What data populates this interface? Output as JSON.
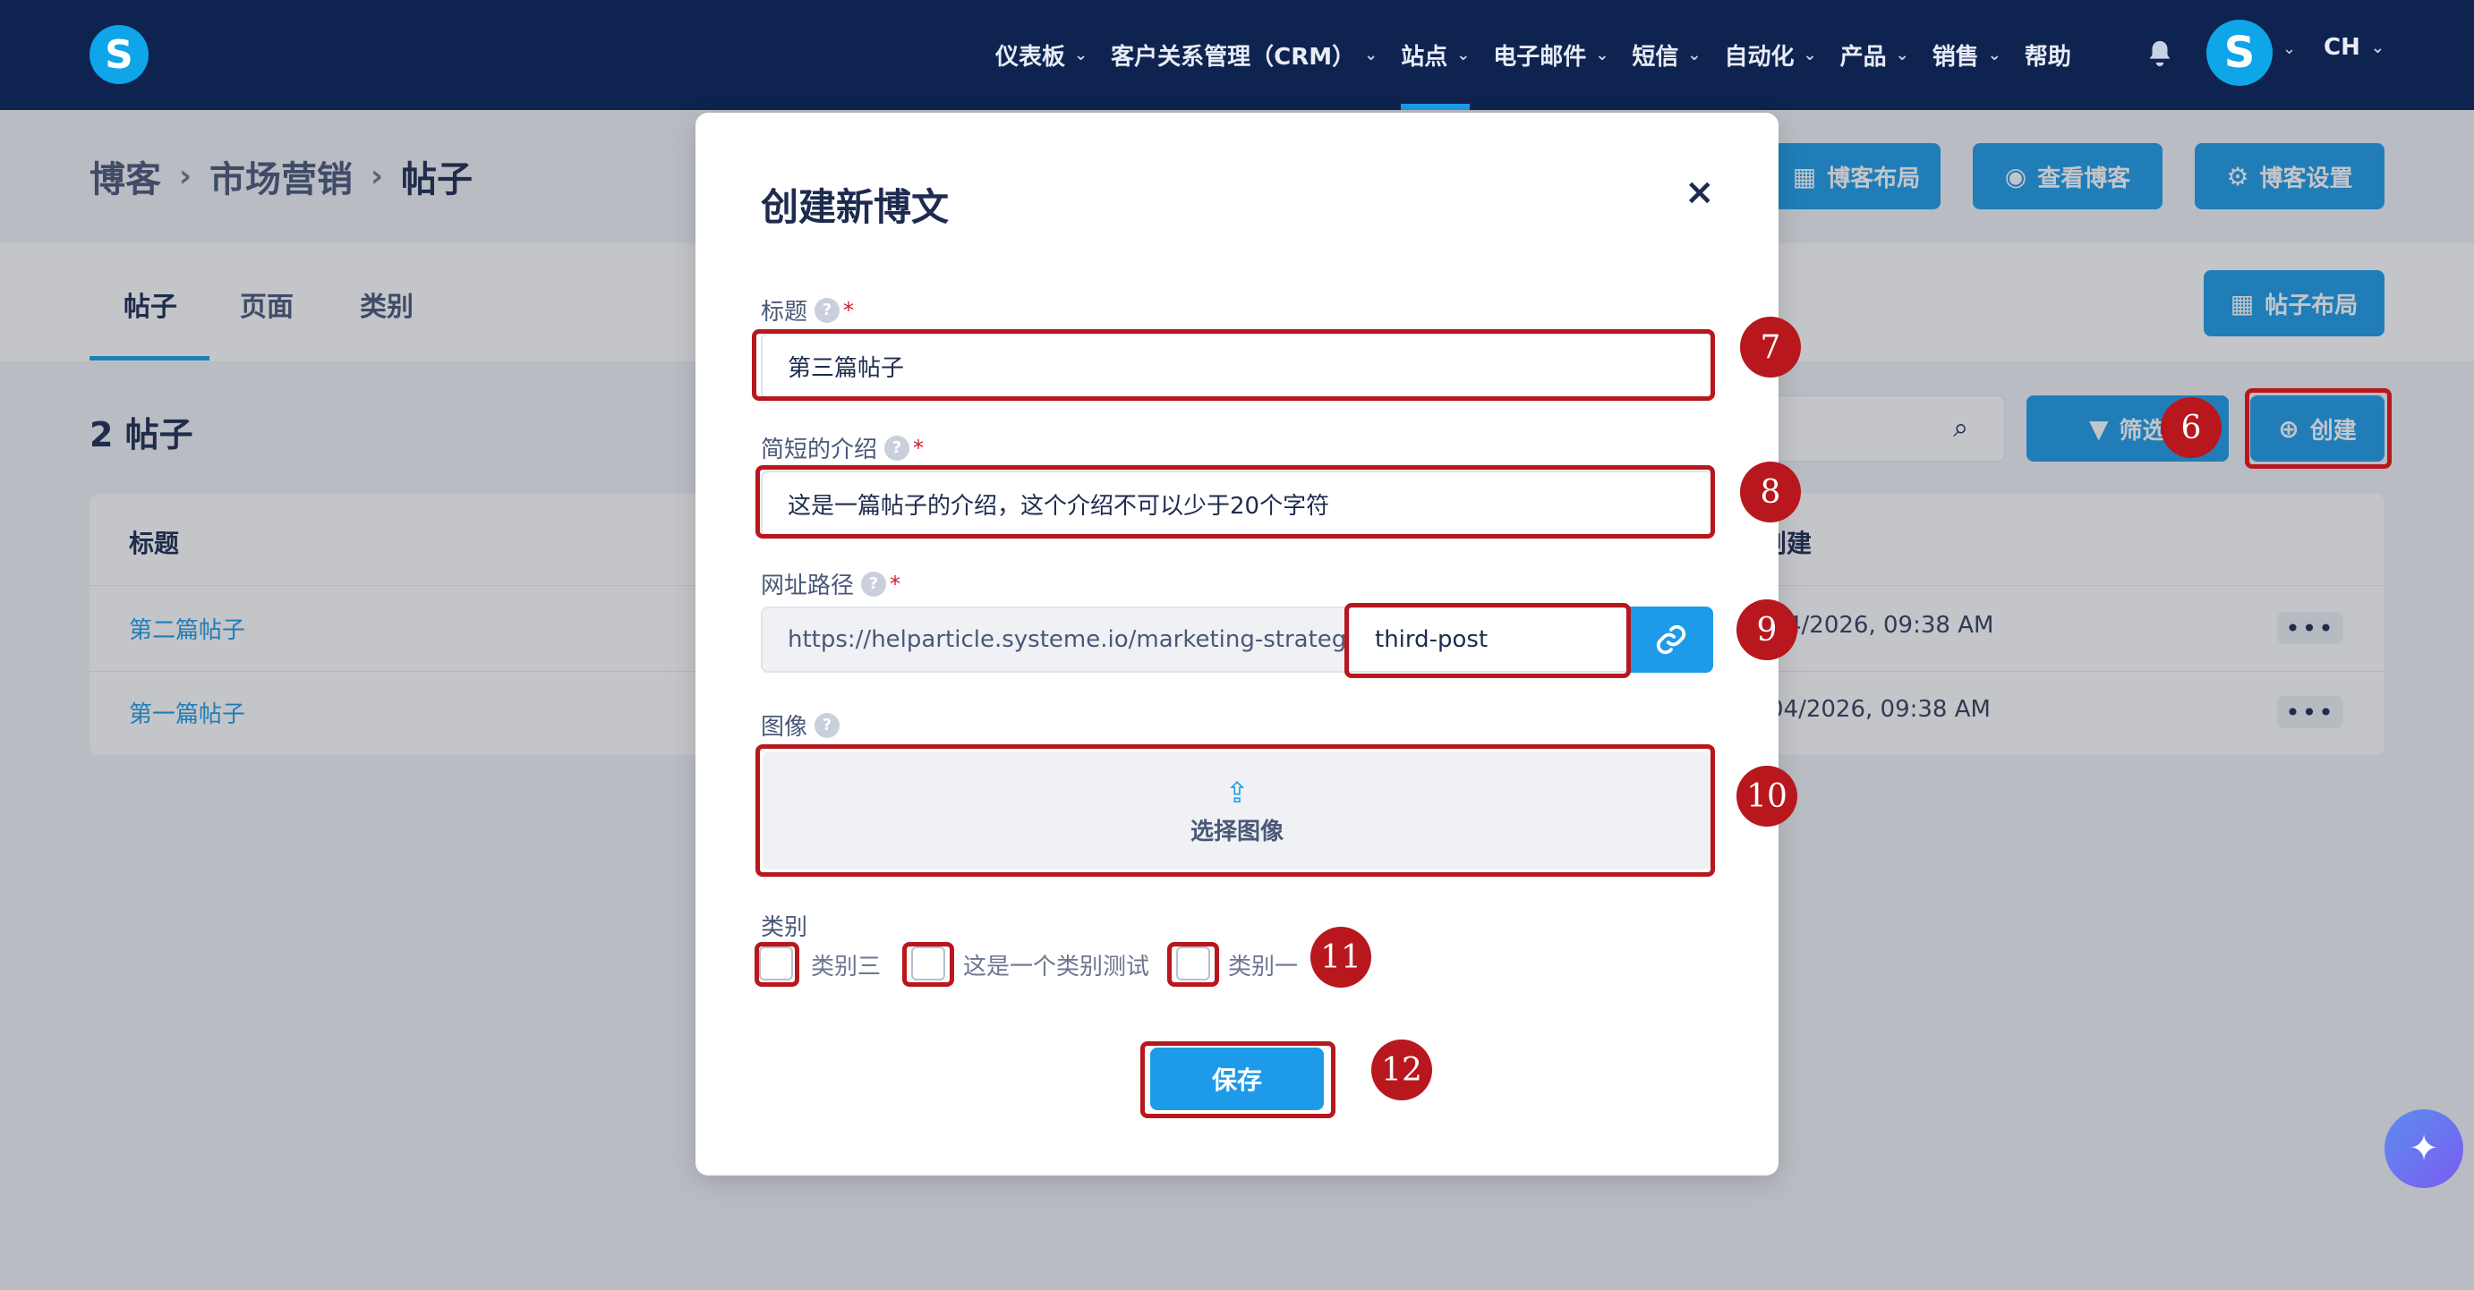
{
  "nav": {
    "items": [
      {
        "label": "仪表板",
        "active": false
      },
      {
        "label": "客户关系管理（CRM）",
        "active": false
      },
      {
        "label": "站点",
        "active": true
      },
      {
        "label": "电子邮件",
        "active": false
      },
      {
        "label": "短信",
        "active": false
      },
      {
        "label": "自动化",
        "active": false
      },
      {
        "label": "产品",
        "active": false
      },
      {
        "label": "销售",
        "active": false
      }
    ],
    "help_label": "帮助",
    "lang": "CH",
    "logo_letter": "S",
    "avatar_letter": "S"
  },
  "breadcrumb": [
    "博客",
    "市场营销",
    "帖子"
  ],
  "header_buttons": {
    "blog_layout": "博客布局",
    "view_blog": "查看博客",
    "blog_settings": "博客设置",
    "post_layout": "帖子布局"
  },
  "tabs": [
    "帖子",
    "页面",
    "类别"
  ],
  "list": {
    "count_title": "2 帖子",
    "filter_label": "筛选",
    "create_label": "创建",
    "col_title": "标题",
    "col_created": "创建",
    "rows": [
      {
        "title": "第二篇帖子",
        "created": "4/2026, 09:38 AM"
      },
      {
        "title": "第一篇帖子",
        "created": "04/2026, 09:38 AM"
      }
    ]
  },
  "modal": {
    "title": "创建新博文",
    "title_label": "标题",
    "title_value": "第三篇帖子",
    "intro_label": "简短的介绍",
    "intro_value": "这是一篇帖子的介绍，这个介绍不可以少于20个字符",
    "url_label": "网址路径",
    "url_prefix": "https://helparticle.systeme.io/marketing-strategics/",
    "url_slug": "third-post",
    "image_label": "图像",
    "image_button": "选择图像",
    "category_label": "类别",
    "categories": [
      "类别三",
      "这是一个类别测试",
      "类别一"
    ],
    "save_label": "保存"
  },
  "annotations": [
    "6",
    "7",
    "8",
    "9",
    "10",
    "11",
    "12"
  ],
  "colors": {
    "nav_bg": "#0f2350",
    "accent": "#1e9be8",
    "annotation": "#b7171d"
  }
}
